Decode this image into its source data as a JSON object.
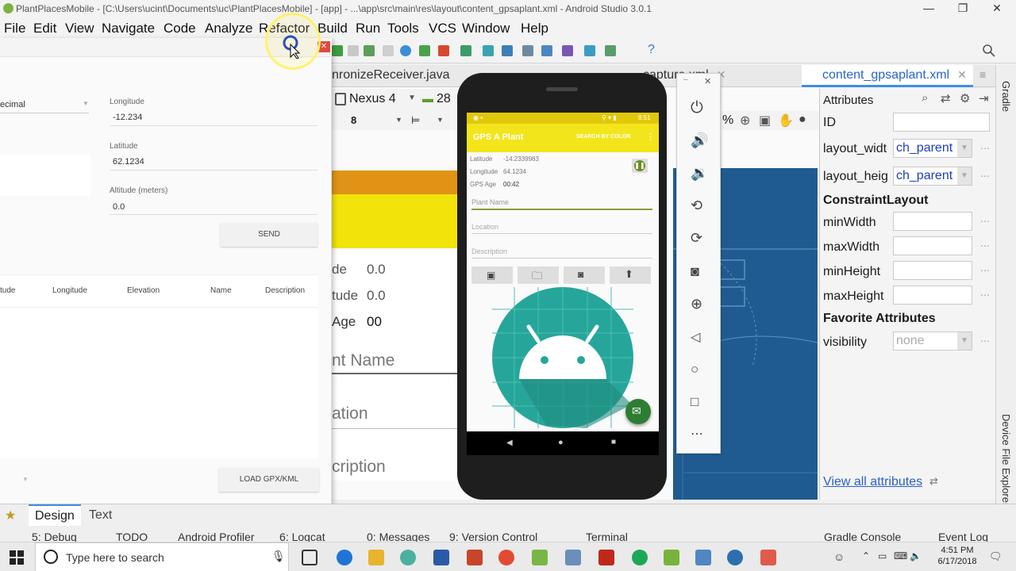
{
  "window": {
    "title": "PlantPlacesMobile - [C:\\Users\\ucint\\Documents\\uc\\PlantPlacesMobile] - [app] - ...\\app\\src\\main\\res\\layout\\content_gpsaplant.xml - Android Studio 3.0.1"
  },
  "menu": [
    "File",
    "Edit",
    "View",
    "Navigate",
    "Code",
    "Analyze",
    "Refactor",
    "Build",
    "Run",
    "Tools",
    "VCS",
    "Window",
    "Help"
  ],
  "tabs": [
    {
      "label": "nronizeReceiver.java"
    },
    {
      "label": "capture.xml"
    },
    {
      "label": "content_gpsaplant.xml"
    }
  ],
  "layout_toolbar": {
    "device": "Nexus 4",
    "api": "28",
    "zoom_text": "%"
  },
  "attributes": {
    "header": "Attributes",
    "rows": [
      {
        "name": "ID",
        "value": ""
      },
      {
        "name": "layout_widt",
        "value": "ch_parent"
      },
      {
        "name": "layout_heig",
        "value": "ch_parent"
      }
    ],
    "section_constraint": "ConstraintLayout",
    "constraint_rows": [
      {
        "name": "minWidth",
        "value": ""
      },
      {
        "name": "maxWidth",
        "value": ""
      },
      {
        "name": "minHeight",
        "value": ""
      },
      {
        "name": "maxHeight",
        "value": ""
      }
    ],
    "section_favorite": "Favorite Attributes",
    "visibility_label": "visibility",
    "visibility_value": "none",
    "view_all_link": "View all attributes"
  },
  "side_labels": {
    "gradle": "Gradle",
    "device_file_explorer": "Device File Explorer"
  },
  "design_preview": {
    "alt_label": "de",
    "alt_value": "0.0",
    "lat_label": "tude",
    "lat_value": "0.0",
    "age_label": "Age",
    "age_value": "00",
    "plant_name": "nt Name",
    "location": "ation",
    "description": "cription"
  },
  "gpx_window": {
    "format_value": "ecimal",
    "longitude_label": "Longitude",
    "longitude_value": "-12.234",
    "latitude_label": "Latitude",
    "latitude_value": "62.1234",
    "altitude_label": "Altitude (meters)",
    "altitude_value": "0.0",
    "send_button": "SEND",
    "columns": [
      "tude",
      "Longitude",
      "Elevation",
      "Name",
      "Description"
    ],
    "load_button": "LOAD GPX/KML"
  },
  "phone_app": {
    "status_time": "8:51",
    "app_title": "GPS A Plant",
    "menu_action": "SEARCH BY COLOR",
    "latitude_label": "Latitude",
    "latitude_value": "-14.2339983",
    "longitude_label": "Longitude",
    "longitude_value": "64.1234",
    "gps_age_label": "GPS Age",
    "gps_age_value": "00:42",
    "plant_name_hint": "Plant Name",
    "location_hint": "Location",
    "description_hint": "Description"
  },
  "bottom_tabs": {
    "design": "Design",
    "text": "Text"
  },
  "tool_windows": [
    "5: Debug",
    "TODO",
    "Android Profiler",
    "6: Logcat",
    "0: Messages",
    "9: Version Control",
    "Terminal",
    "Gradle Console",
    "Event Log"
  ],
  "taskbar": {
    "search_placeholder": "Type here to search",
    "time": "4:51 PM",
    "date": "6/17/2018"
  },
  "colors": {
    "accent_blue": "#3d8ee8",
    "blueprint": "#1f5b90",
    "app_yellow": "#f3e51b",
    "android_teal": "#26a69a",
    "fab_green": "#2e7d32"
  }
}
